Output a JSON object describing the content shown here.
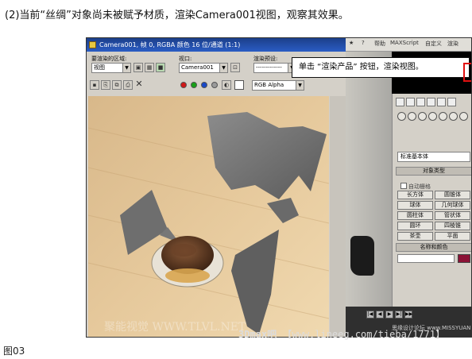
{
  "caption": "(2)当前“丝绸”对象尚未被赋予材质，渲染Camera001视图，观察其效果。",
  "figure_label": "图03",
  "render_window": {
    "title": "Camera001, 帧 0, RGBA 颜色 16 位/通道 (1:1)",
    "area_label": "要渲染的区域:",
    "area_value": "视图",
    "viewport_label": "视口:",
    "viewport_value": "Camera001",
    "preset_label": "渲染预设:",
    "preset_value": "-------------",
    "channel_value": "RGB Alpha",
    "colors": {
      "red": "#d01818",
      "green": "#18a018",
      "blue": "#1848c8",
      "gray": "#9a9a9a"
    },
    "watermark": "聚能视觉 WWW.TLVL.NET"
  },
  "menubar": {
    "items": [
      "★",
      "?",
      "帮助",
      "MAXScript",
      "自定义",
      "渲染"
    ]
  },
  "command_panel": {
    "dropdown": "标准基本体",
    "object_type_title": "对象类型",
    "autogrid": "自动栅格",
    "buttons": [
      "长方体",
      "圆锥体",
      "球体",
      "几何球体",
      "圆柱体",
      "管状体",
      "圆环",
      "四棱锥",
      "茶壶",
      "平面"
    ],
    "name_color_title": "名称和颜色",
    "object_color": "#8b1236"
  },
  "callout": "单击 “渲染产品” 按钮，渲染视图。",
  "status": {
    "text": "思缘设计论坛 www.MISSYUAN.COM"
  },
  "watermark": {
    "brand": "3Dmax吧",
    "url": "【www.lineeg.com/tieba/1771】"
  }
}
